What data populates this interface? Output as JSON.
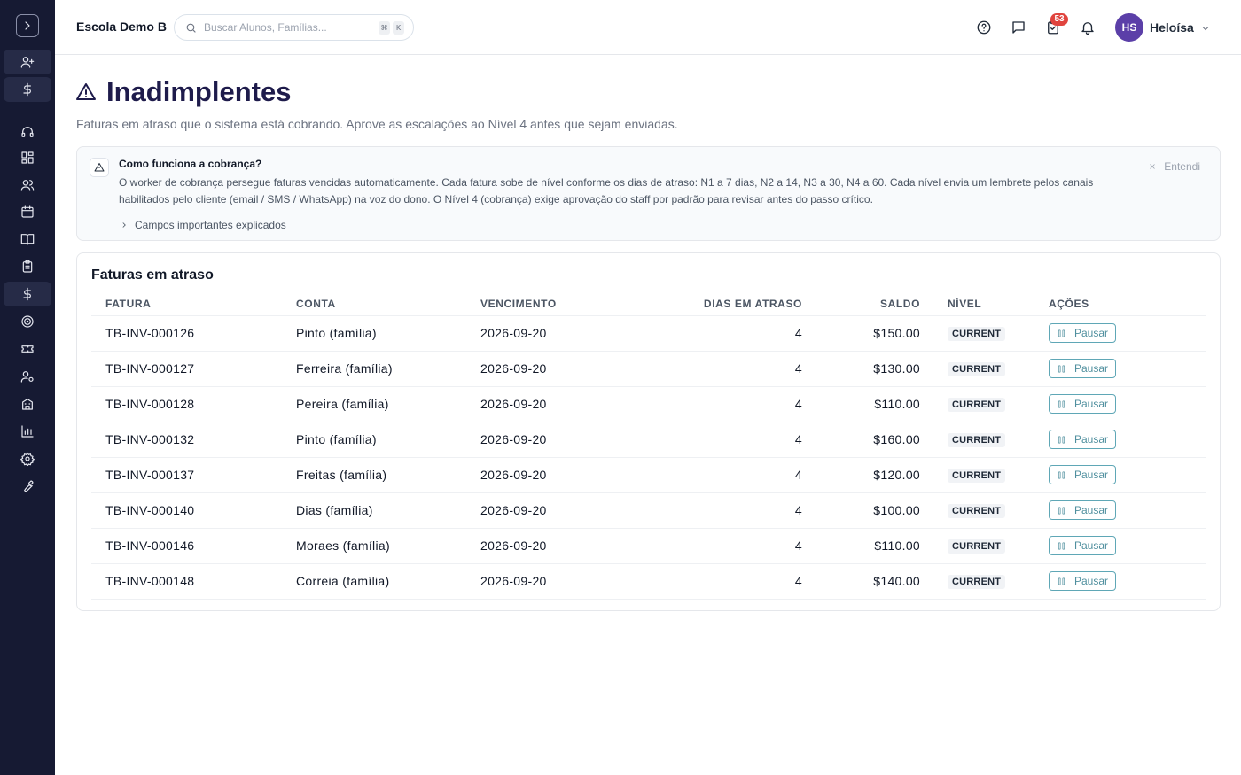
{
  "header": {
    "school_name": "Escola Demo B",
    "search_placeholder": "Buscar Alunos, Famílias...",
    "shortcut_keys": [
      "⌘",
      "K"
    ],
    "notification_count": "53",
    "user_initials": "HS",
    "user_name": "Heloísa"
  },
  "page": {
    "title": "Inadimplentes",
    "subtitle": "Faturas em atraso que o sistema está cobrando. Aprove as escalações ao Nível 4 antes que sejam enviadas."
  },
  "info": {
    "title": "Como funciona a cobrança?",
    "body": "O worker de cobrança persegue faturas vencidas automaticamente. Cada fatura sobe de nível conforme os dias de atraso: N1 a 7 dias, N2 a 14, N3 a 30, N4 a 60. Cada nível envia um lembrete pelos canais habilitados pelo cliente (email / SMS / WhatsApp) na voz do dono. O Nível 4 (cobrança) exige aprovação do staff por padrão para revisar antes do passo crítico.",
    "fields_toggle": "Campos importantes explicados",
    "dismiss_label": "Entendi"
  },
  "table": {
    "title": "Faturas em atraso",
    "columns": [
      "FATURA",
      "CONTA",
      "VENCIMENTO",
      "DIAS EM ATRASO",
      "SALDO",
      "NÍVEL",
      "AÇÕES"
    ],
    "pause_label": "Pausar",
    "rows": [
      {
        "invoice": "TB-INV-000126",
        "account": "Pinto (família)",
        "due": "2026-09-20",
        "days": "4",
        "balance": "$150.00",
        "level": "CURRENT"
      },
      {
        "invoice": "TB-INV-000127",
        "account": "Ferreira (família)",
        "due": "2026-09-20",
        "days": "4",
        "balance": "$130.00",
        "level": "CURRENT"
      },
      {
        "invoice": "TB-INV-000128",
        "account": "Pereira (família)",
        "due": "2026-09-20",
        "days": "4",
        "balance": "$110.00",
        "level": "CURRENT"
      },
      {
        "invoice": "TB-INV-000132",
        "account": "Pinto (família)",
        "due": "2026-09-20",
        "days": "4",
        "balance": "$160.00",
        "level": "CURRENT"
      },
      {
        "invoice": "TB-INV-000137",
        "account": "Freitas (família)",
        "due": "2026-09-20",
        "days": "4",
        "balance": "$120.00",
        "level": "CURRENT"
      },
      {
        "invoice": "TB-INV-000140",
        "account": "Dias (família)",
        "due": "2026-09-20",
        "days": "4",
        "balance": "$100.00",
        "level": "CURRENT"
      },
      {
        "invoice": "TB-INV-000146",
        "account": "Moraes (família)",
        "due": "2026-09-20",
        "days": "4",
        "balance": "$110.00",
        "level": "CURRENT"
      },
      {
        "invoice": "TB-INV-000148",
        "account": "Correia (família)",
        "due": "2026-09-20",
        "days": "4",
        "balance": "$140.00",
        "level": "CURRENT"
      }
    ]
  },
  "colors": {
    "sidebar_bg": "#161a33",
    "title": "#1e1b4b",
    "avatar": "#5b3fa8",
    "badge": "#e0443e",
    "pause_accent": "#4f8f9e"
  },
  "sidebar_icons": [
    "chevron-right-icon",
    "user-plus-icon",
    "dollar-icon",
    "headset-icon",
    "grid-icon",
    "users-icon",
    "calendar-icon",
    "book-icon",
    "clipboard-icon",
    "dollar-icon",
    "target-icon",
    "ticket-icon",
    "user-cog-icon",
    "building-icon",
    "bar-chart-icon",
    "gear-icon",
    "wrench-icon"
  ]
}
